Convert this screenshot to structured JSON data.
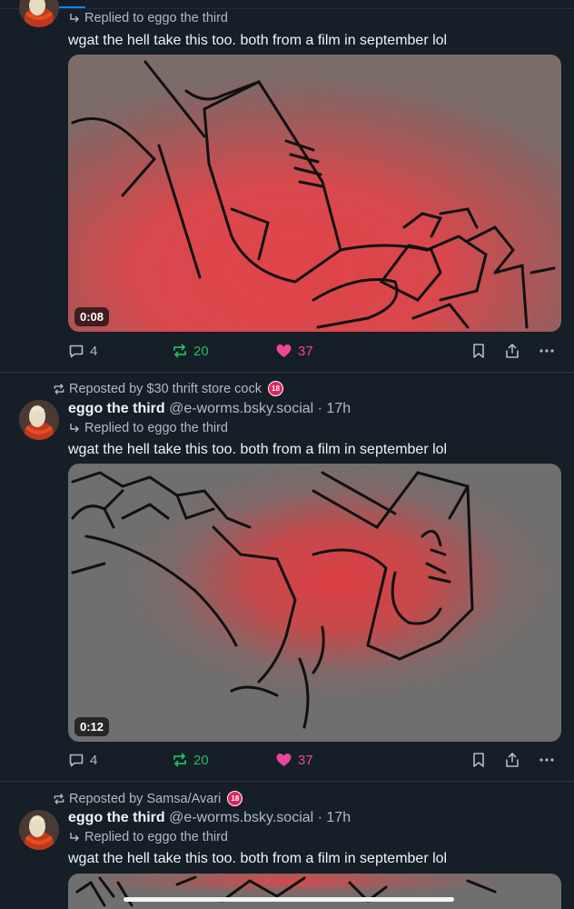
{
  "colors": {
    "background": "#161e27",
    "accent": "#1083fe",
    "repost_green": "#20bc61",
    "like_pink": "#ec4899",
    "muted": "#aebbc9"
  },
  "posts": [
    {
      "repost_by": "",
      "author_name": "",
      "author_handle": "",
      "time": "",
      "reply_label": "Replied to eggo the third",
      "text": "wgat the hell take this too. both from a film in september lol",
      "video_duration": "0:08",
      "reply_count": "4",
      "repost_count": "20",
      "like_count": "37"
    },
    {
      "repost_by": "Reposted by $30 thrift store cock",
      "nsfw_badge": "18",
      "author_name": "eggo the third",
      "author_handle": "@e-worms.bsky.social",
      "time": "· 17h",
      "reply_label": "Replied to eggo the third",
      "text": "wgat the hell take this too. both from a film in september lol",
      "video_duration": "0:12",
      "reply_count": "4",
      "repost_count": "20",
      "like_count": "37"
    },
    {
      "repost_by": "Reposted by Samsa/Avari",
      "nsfw_badge": "18",
      "author_name": "eggo the third",
      "author_handle": "@e-worms.bsky.social",
      "time": "· 17h",
      "reply_label": "Replied to eggo the third",
      "text": "wgat the hell take this too. both from a film in september lol"
    }
  ],
  "icons": {
    "reply": "speech-bubble-icon",
    "repost": "repost-arrows-icon",
    "like": "heart-icon",
    "bookmark": "bookmark-icon",
    "share": "share-icon",
    "more": "ellipsis-icon"
  }
}
